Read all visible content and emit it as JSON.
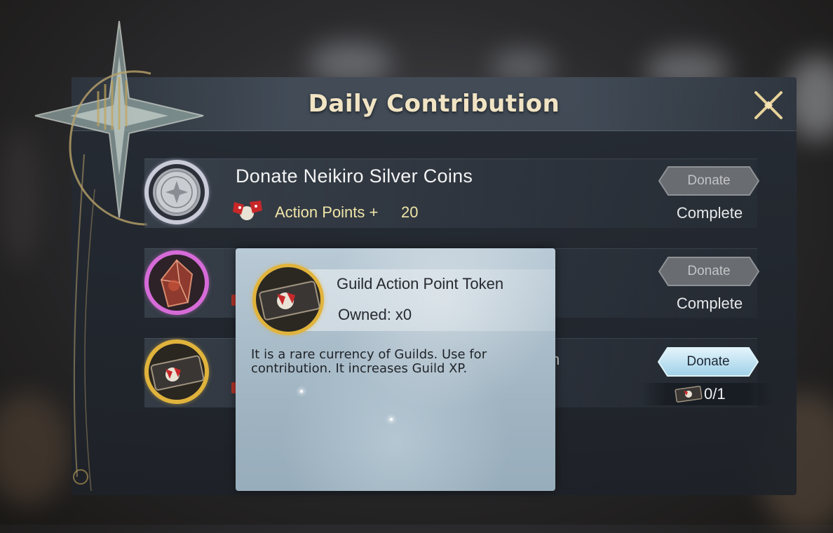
{
  "dialog": {
    "title": "Daily Contribution",
    "close_icon": "close-x-icon"
  },
  "rows": [
    {
      "title": "Donate Neikiro Silver Coins",
      "icon": "silver-coin-icon",
      "ring_color": "#c9cbd8",
      "reward_icon": "action-points-flag-icon",
      "reward_label": "Action Points +",
      "reward_value": "20",
      "button_label": "Donate",
      "button_state": "disabled",
      "status": "Complete"
    },
    {
      "icon": "red-crystal-icon",
      "ring_color": "#d66bd8",
      "button_label": "Donate",
      "button_state": "disabled",
      "status": "Complete"
    },
    {
      "icon": "guild-token-icon",
      "ring_color": "#e0b33c",
      "button_label": "Donate",
      "button_state": "active",
      "cost_icon": "guild-token-icon",
      "cost": "0/1"
    }
  ],
  "tooltip": {
    "item_name": "Guild Action Point Token",
    "owned": "Owned: x0",
    "description": "It is a rare currency of Guilds. Use for contribution. It increases Guild XP.",
    "icon": "guild-token-icon"
  },
  "colors": {
    "title": "#f1e4c4",
    "reward_text": "#efe5a8",
    "active_button": "#bfe3f3",
    "disabled_button": "#6a6d70"
  }
}
